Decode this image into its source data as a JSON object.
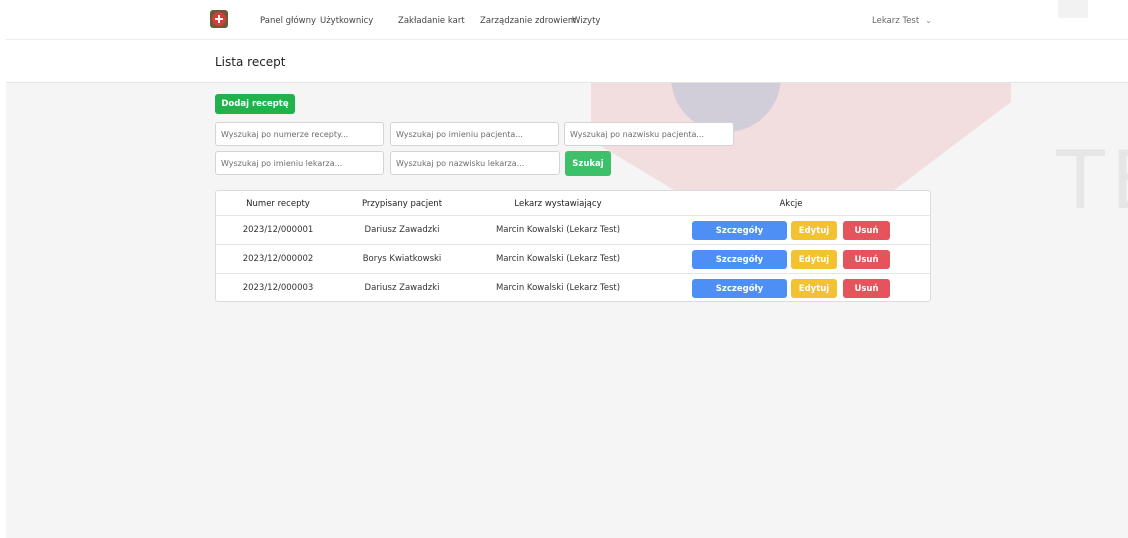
{
  "nav": {
    "items": [
      "Panel główny",
      "Użytkownicy",
      "Zakładanie kart",
      "Zarządzanie zdrowiem",
      "Wizyty"
    ],
    "user": "Lekarz Test"
  },
  "watermark": "TE",
  "page": {
    "title": "Lista recept"
  },
  "actions": {
    "add_label": "Dodaj receptę",
    "search_label": "Szukaj"
  },
  "search": {
    "prescription_number": "Wyszukaj po numerze recepty...",
    "patient_first_name": "Wyszukaj po imieniu pacjenta...",
    "patient_last_name": "Wyszukaj po nazwisku pacjenta...",
    "doctor_first_name": "Wyszukaj po imieniu lekarza...",
    "doctor_last_name": "Wyszukaj po nazwisku lekarza..."
  },
  "table": {
    "headers": [
      "Numer recepty",
      "Przypisany pacjent",
      "Lekarz wystawiający",
      "Akcje"
    ],
    "rows": [
      {
        "number": "2023/12/000001",
        "patient": "Dariusz Zawadzki",
        "doctor": "Marcin Kowalski (Lekarz Test)"
      },
      {
        "number": "2023/12/000002",
        "patient": "Borys Kwiatkowski",
        "doctor": "Marcin Kowalski (Lekarz Test)"
      },
      {
        "number": "2023/12/000003",
        "patient": "Dariusz Zawadzki",
        "doctor": "Marcin Kowalski (Lekarz Test)"
      }
    ],
    "row_actions": {
      "details": "Szczegóły",
      "edit": "Edytuj",
      "delete": "Usuń"
    }
  },
  "colors": {
    "add": "#22b24c",
    "search": "#3cc16a",
    "details": "#4d8ff5",
    "edit": "#f2c230",
    "delete": "#e5535d",
    "logo": "#d93a3a"
  },
  "icons": {
    "logo": "medical-cross-logo-icon",
    "user_dropdown": "chevron-down-icon"
  }
}
